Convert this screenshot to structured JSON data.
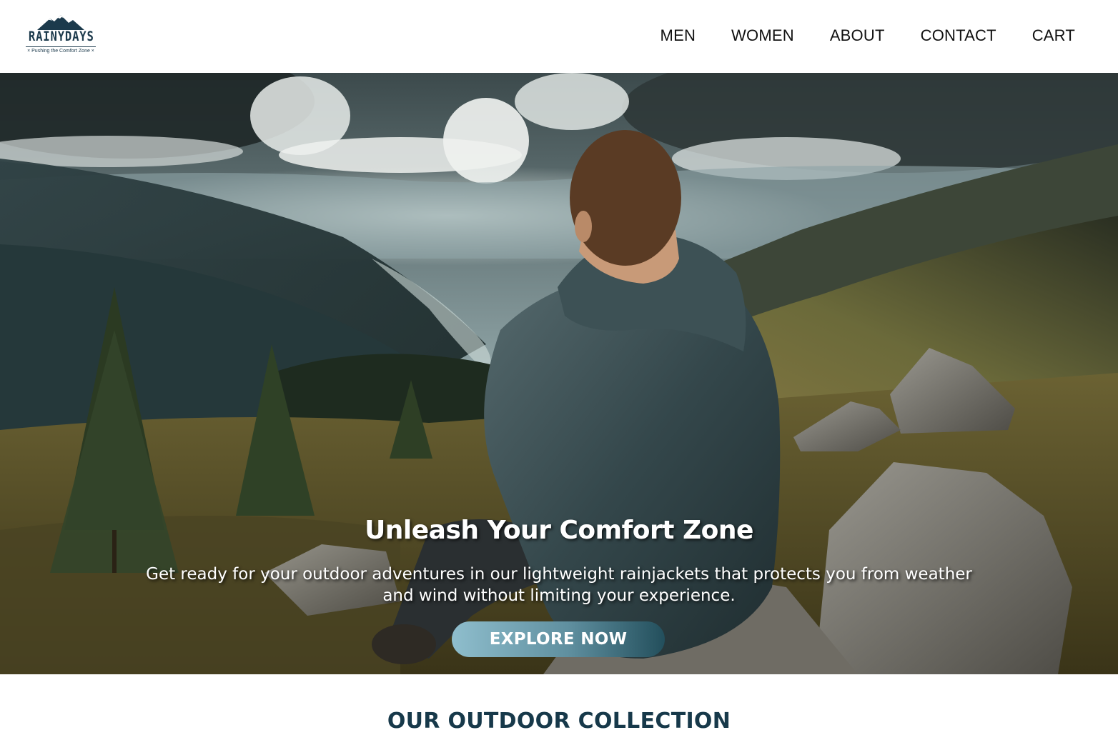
{
  "brand": {
    "name": "RAINYDAYS",
    "tagline": "× Pushing the Comfort Zone ×",
    "color": "#1c3a4c"
  },
  "nav": {
    "items": [
      {
        "label": "MEN"
      },
      {
        "label": "WOMEN"
      },
      {
        "label": "ABOUT"
      },
      {
        "label": "CONTACT"
      },
      {
        "label": "CART"
      }
    ]
  },
  "hero": {
    "title": "Unleash Your Comfort Zone",
    "text": "Get ready for your outdoor adventures in our lightweight rainjackets that protects you from weather and wind without limiting your experience.",
    "cta_label": "EXPLORE NOW",
    "cta_colors": [
      "#8fbecd",
      "#234f5c"
    ]
  },
  "collection": {
    "title": "OUR OUTDOOR COLLECTION",
    "title_color": "#17394a"
  }
}
